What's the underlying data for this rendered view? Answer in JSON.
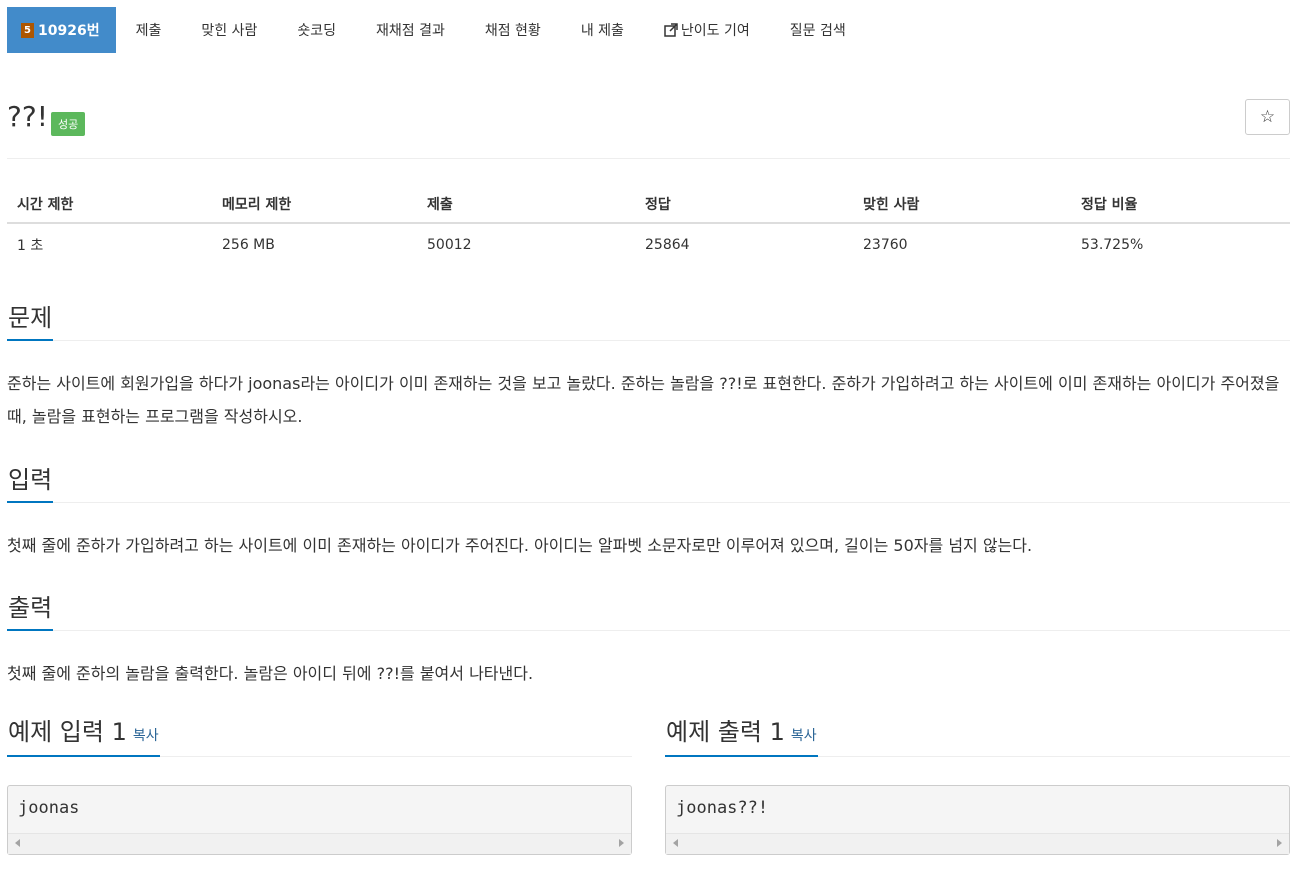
{
  "nav": {
    "problem_tier": "5",
    "problem_number": "10926번",
    "items": [
      "제출",
      "맞힌 사람",
      "숏코딩",
      "재채점 결과",
      "채점 현황",
      "내 제출",
      "난이도 기여",
      "질문 검색"
    ]
  },
  "problem": {
    "title": "??!",
    "badge": "성공",
    "star": "☆"
  },
  "info": {
    "headers": [
      "시간 제한",
      "메모리 제한",
      "제출",
      "정답",
      "맞힌 사람",
      "정답 비율"
    ],
    "values": [
      "1 초",
      "256 MB",
      "50012",
      "25864",
      "23760",
      "53.725%"
    ]
  },
  "sections": {
    "problem_head": "문제",
    "problem_text": "준하는 사이트에 회원가입을 하다가 joonas라는 아이디가 이미 존재하는 것을 보고 놀랐다. 준하는 놀람을 ??!로 표현한다. 준하가 가입하려고 하는 사이트에 이미 존재하는 아이디가 주어졌을 때, 놀람을 표현하는 프로그램을 작성하시오.",
    "input_head": "입력",
    "input_text": "첫째 줄에 준하가 가입하려고 하는 사이트에 이미 존재하는 아이디가 주어진다. 아이디는 알파벳 소문자로만 이루어져 있으며, 길이는 50자를 넘지 않는다.",
    "output_head": "출력",
    "output_text": "첫째 줄에 준하의 놀람을 출력한다. 놀람은 아이디 뒤에 ??!를 붙여서 나타낸다."
  },
  "samples": {
    "input_title": "예제 입력 1",
    "output_title": "예제 출력 1",
    "copy_label": "복사",
    "input_value": "joonas",
    "output_value": "joonas??!"
  },
  "colors": {
    "active_tab": "#428bca",
    "success": "#5cb85c",
    "accent_underline": "#0076c0",
    "tier_bronze": "#ad5600"
  }
}
